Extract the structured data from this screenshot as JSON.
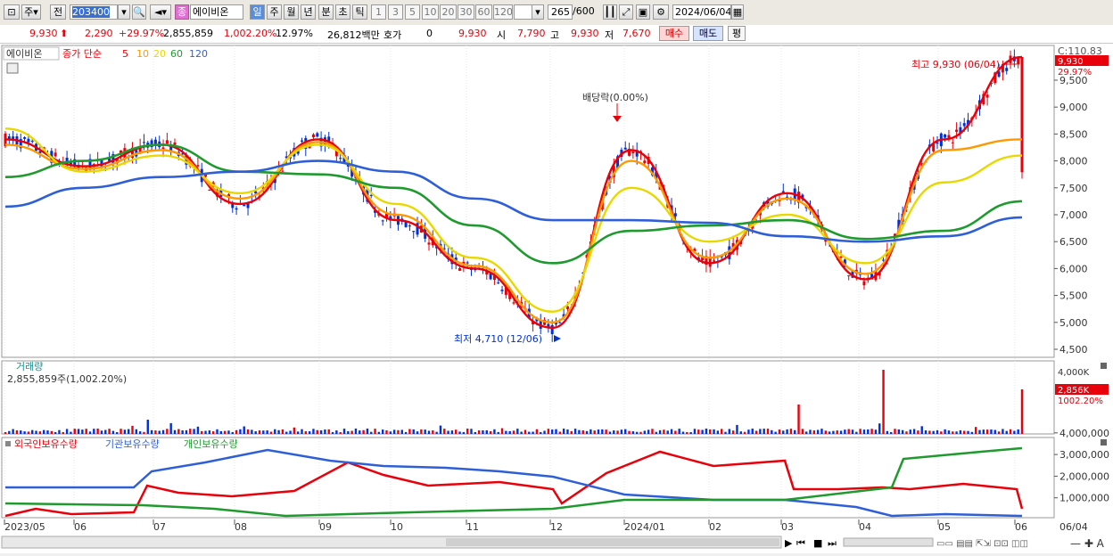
{
  "toolbar": {
    "market": "주",
    "mode": "전",
    "code": "203400",
    "badge": "종",
    "stock_name": "에이비온",
    "periods": [
      "일",
      "주",
      "월",
      "년",
      "분",
      "초",
      "틱"
    ],
    "selected_period": "일",
    "intervals": [
      "1",
      "3",
      "5",
      "10",
      "20",
      "30",
      "60",
      "120"
    ],
    "count": "265",
    "count_total": "/600",
    "date": "2024/06/04"
  },
  "quote": {
    "price": "9,930",
    "change": "2,290",
    "change_pct": "+29.97%",
    "volume": "2,855,859",
    "volume_ratio": "1,002.20%",
    "turnover": "12.97%",
    "amount": "26,812백만",
    "hoga_label": "호가",
    "hoga_value": "0",
    "hoga_price": "9,930",
    "open_label": "시",
    "open": "7,790",
    "high_label": "고",
    "high": "9,930",
    "low_label": "저",
    "low": "7,670",
    "buy_label": "매수",
    "sell_label": "매도",
    "eval_label": "평"
  },
  "legend": {
    "name": "에이비온",
    "ma_label": "종가 단순",
    "ma_periods": [
      {
        "label": "5",
        "color": "#e8000a"
      },
      {
        "label": "10",
        "color": "#ff9900"
      },
      {
        "label": "20",
        "color": "#e8d800"
      },
      {
        "label": "60",
        "color": "#1f9a2e"
      },
      {
        "label": "120",
        "color": "#2f5fd6"
      }
    ]
  },
  "price_axis": {
    "ticks": [
      "9,500",
      "9,000",
      "8,500",
      "8,000",
      "7,500",
      "7,000",
      "6,500",
      "6,000",
      "5,500",
      "5,000",
      "4,500"
    ],
    "top_label": "C:110.83",
    "current": "9,930",
    "current_pct": "29.97%"
  },
  "annotations": {
    "high": "최고 9,930 (06/04)",
    "low": "최저 4,710 (12/06)",
    "dividend": "배당락(0.00%)"
  },
  "volume_panel": {
    "title": "거래량",
    "value_text": "2,855,859주(1,002.20%)",
    "axis_top": "4,000K",
    "current": "2,856K",
    "current_pct": "1002.20%"
  },
  "holdings_panel": {
    "series": [
      {
        "label": "외국인보유수량",
        "color": "#e8000a"
      },
      {
        "label": "기관보유수량",
        "color": "#2f5fd6"
      },
      {
        "label": "개인보유수량",
        "color": "#1f9a2e"
      }
    ],
    "ticks": [
      "4,000,000",
      "3,000,000",
      "2,000,000",
      "1,000,000"
    ]
  },
  "x_axis": {
    "labels": [
      "2023/05",
      "06",
      "07",
      "08",
      "09",
      "10",
      "11",
      "12",
      "2024/01",
      "02",
      "03",
      "04",
      "05",
      "06"
    ],
    "last": "06/04"
  },
  "chart_data": {
    "type": "line",
    "title": "",
    "xlabel": "",
    "ylabel": "",
    "ylim": [
      4500,
      9930
    ],
    "x": [
      "2023/05",
      "06",
      "07",
      "08",
      "09",
      "10",
      "11",
      "12",
      "2024/01",
      "02",
      "03",
      "04",
      "05",
      "06"
    ],
    "series": [
      {
        "name": "5",
        "values": [
          8400,
          7900,
          8300,
          7200,
          8400,
          6900,
          6000,
          4900,
          8200,
          6100,
          7400,
          5800,
          8400,
          9930
        ]
      },
      {
        "name": "10",
        "values": [
          8300,
          7850,
          8200,
          7300,
          8350,
          7000,
          6050,
          5000,
          8000,
          6200,
          7300,
          5900,
          8200,
          8400
        ]
      },
      {
        "name": "20",
        "values": [
          8600,
          7800,
          8100,
          7400,
          8300,
          7200,
          6200,
          5200,
          7500,
          6500,
          7000,
          6100,
          7600,
          8100
        ]
      },
      {
        "name": "60",
        "values": [
          7700,
          8000,
          8300,
          7800,
          7750,
          7500,
          6800,
          6100,
          6700,
          6800,
          6900,
          6550,
          6700,
          7250
        ]
      },
      {
        "name": "120",
        "values": [
          7150,
          7500,
          7700,
          7800,
          8000,
          7800,
          7300,
          6900,
          6900,
          6850,
          6600,
          6500,
          6600,
          6950
        ]
      }
    ],
    "annotations": {
      "high": 9930,
      "low": 4710,
      "last_change_pct": 29.97
    },
    "volume_last": 2855859
  }
}
